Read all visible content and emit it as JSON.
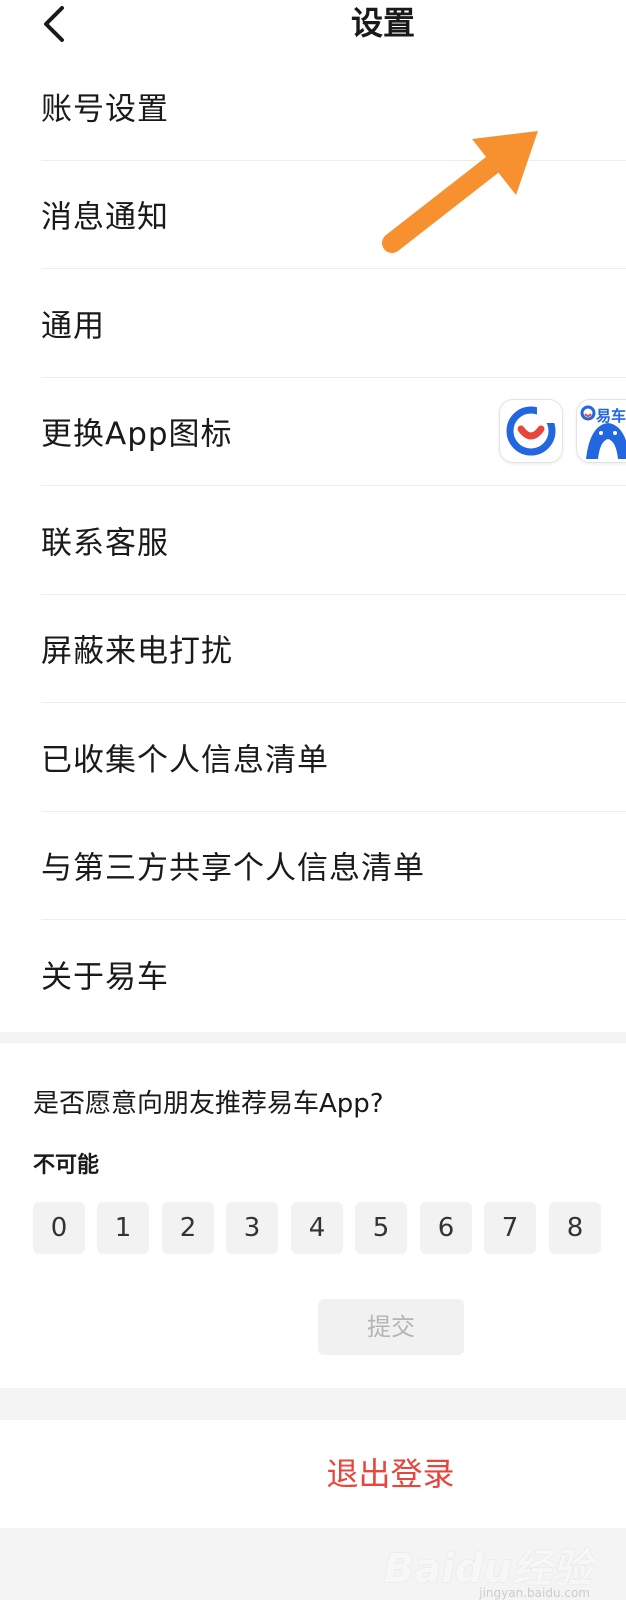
{
  "header": {
    "title": "设置"
  },
  "settings": {
    "items": [
      {
        "label": "账号设置"
      },
      {
        "label": "消息通知"
      },
      {
        "label": "通用"
      },
      {
        "label": "更换App图标"
      },
      {
        "label": "联系客服"
      },
      {
        "label": "屏蔽来电打扰"
      },
      {
        "label": "已收集个人信息清单"
      },
      {
        "label": "与第三方共享个人信息清单"
      },
      {
        "label": "关于易车"
      }
    ],
    "app_icon_b_text": "易车"
  },
  "survey": {
    "question": "是否愿意向朋友推荐易车App?",
    "low_label": "不可能",
    "scores": [
      "0",
      "1",
      "2",
      "3",
      "4",
      "5",
      "6",
      "7",
      "8"
    ],
    "submit_label": "提交"
  },
  "logout": {
    "label": "退出登录"
  },
  "watermark": {
    "text": "Baidu经验",
    "sub": "jingyan.baidu.com"
  },
  "colors": {
    "logout": "#e8463c",
    "arrow": "#f7902f",
    "brand_blue": "#2266e0",
    "brand_red": "#e8463c"
  },
  "icons": [
    "chevron-left-icon",
    "app-icon-default",
    "app-icon-shark",
    "annotation-arrow"
  ]
}
